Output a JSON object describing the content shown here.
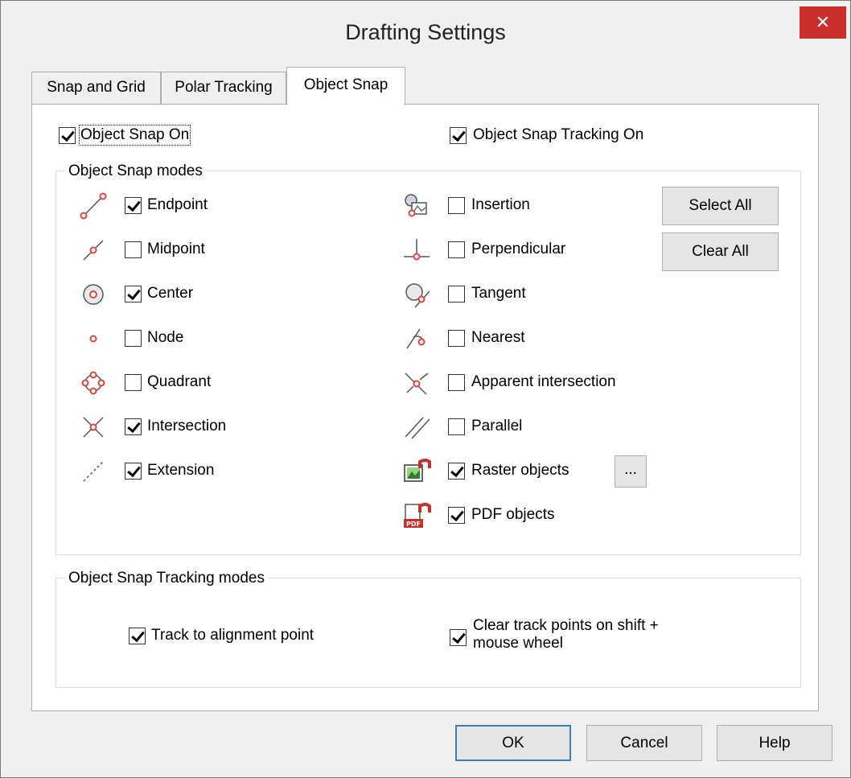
{
  "window": {
    "title": "Drafting Settings",
    "close_glyph": "✕"
  },
  "tabs": [
    {
      "label": "Snap and Grid",
      "active": false
    },
    {
      "label": "Polar Tracking",
      "active": false
    },
    {
      "label": "Object Snap",
      "active": true
    }
  ],
  "top": {
    "object_snap_on": {
      "label": "Object Snap On",
      "checked": true
    },
    "object_snap_tracking_on": {
      "label": "Object Snap Tracking On",
      "checked": true
    }
  },
  "modes": {
    "title": "Object Snap modes",
    "left": [
      {
        "label": "Endpoint",
        "checked": true,
        "icon": "endpoint-icon"
      },
      {
        "label": "Midpoint",
        "checked": false,
        "icon": "midpoint-icon"
      },
      {
        "label": "Center",
        "checked": true,
        "icon": "center-icon"
      },
      {
        "label": "Node",
        "checked": false,
        "icon": "node-icon"
      },
      {
        "label": "Quadrant",
        "checked": false,
        "icon": "quadrant-icon"
      },
      {
        "label": "Intersection",
        "checked": true,
        "icon": "intersection-icon"
      },
      {
        "label": "Extension",
        "checked": true,
        "icon": "extension-icon"
      }
    ],
    "right": [
      {
        "label": "Insertion",
        "checked": false,
        "icon": "insertion-icon"
      },
      {
        "label": "Perpendicular",
        "checked": false,
        "icon": "perpendicular-icon"
      },
      {
        "label": "Tangent",
        "checked": false,
        "icon": "tangent-icon"
      },
      {
        "label": "Nearest",
        "checked": false,
        "icon": "nearest-icon"
      },
      {
        "label": "Apparent intersection",
        "checked": false,
        "icon": "apparent-intersection-icon"
      },
      {
        "label": "Parallel",
        "checked": false,
        "icon": "parallel-icon"
      },
      {
        "label": "Raster objects",
        "checked": true,
        "icon": "raster-objects-icon"
      },
      {
        "label": "PDF objects",
        "checked": true,
        "icon": "pdf-objects-icon"
      }
    ],
    "select_all_label": "Select All",
    "clear_all_label": "Clear All",
    "raster_more_label": "..."
  },
  "tracking": {
    "title": "Object Snap Tracking modes",
    "track_alignment": {
      "label": "Track to alignment point",
      "checked": true
    },
    "clear_track": {
      "label": "Clear track points on shift + mouse wheel",
      "checked": true
    }
  },
  "footer": {
    "ok_label": "OK",
    "cancel_label": "Cancel",
    "help_label": "Help"
  },
  "colors": {
    "accent_red": "#c7302b",
    "snap_marker": "#e0453a",
    "default_button_border": "#3c7fb1"
  }
}
